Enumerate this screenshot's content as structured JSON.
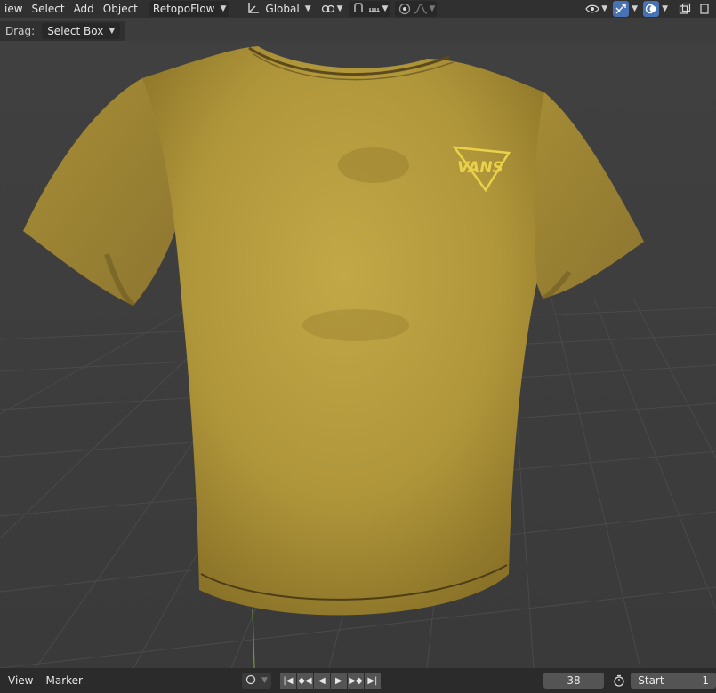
{
  "header": {
    "menus": [
      "iew",
      "Select",
      "Add",
      "Object"
    ],
    "addon_dropdown": "RetopoFlow",
    "orientation_dropdown": "Global",
    "icons": {
      "orientation": "transform-orientation-icon",
      "pivot": "pivot-point-icon",
      "snap": "snap-magnet-icon",
      "snap_target": "snap-increment-icon",
      "proportional": "proportional-edit-icon",
      "falloff": "falloff-curve-icon",
      "visibility": "eye-visibility-icon",
      "gizmo": "gizmo-icon",
      "overlay": "overlay-icon",
      "xray": "xray-icon"
    }
  },
  "tool_settings": {
    "drag_label": "Drag:",
    "drag_value": "Select Box"
  },
  "viewport": {
    "object": "t-shirt-mesh",
    "logo_text": "VANS",
    "colors": {
      "shirt": "#b49a3a",
      "background": "#3d3d3d",
      "grid": "#4a4a4a",
      "axis_green": "#6a9a3a"
    }
  },
  "timeline": {
    "menus": [
      "View",
      "Marker"
    ],
    "current_frame": "38",
    "start_label": "Start",
    "start_value": "1"
  }
}
